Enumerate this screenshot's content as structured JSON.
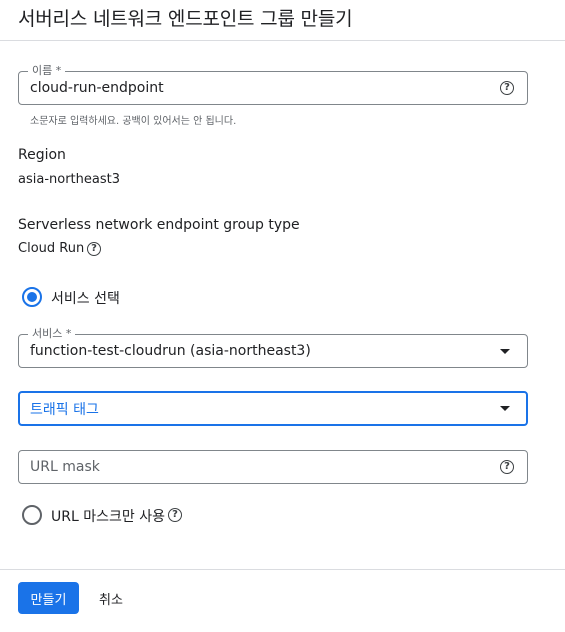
{
  "page": {
    "title": "서버리스 네트워크 엔드포인트 그룹 만들기"
  },
  "name_field": {
    "label": "이름 *",
    "value": "cloud-run-endpoint",
    "hint": "소문자로 입력하세요. 공백이 있어서는 안 됩니다."
  },
  "region": {
    "label": "Region",
    "value": "asia-northeast3"
  },
  "neg_type": {
    "label": "Serverless network endpoint group type",
    "value": "Cloud Run"
  },
  "service_option": {
    "label": "서비스 선택",
    "checked": true
  },
  "service_select": {
    "label": "서비스 *",
    "value": "function-test-cloudrun (asia-northeast3)"
  },
  "traffic_tag_select": {
    "placeholder": "트래픽 태그"
  },
  "url_mask_field": {
    "placeholder": "URL mask"
  },
  "url_mask_option": {
    "label": "URL 마스크만 사용",
    "checked": false
  },
  "actions": {
    "create": "만들기",
    "cancel": "취소"
  },
  "colors": {
    "accent": "#1a73e8",
    "text": "#202124",
    "muted": "#5f6368",
    "border": "#80868b"
  },
  "icons": {
    "help": "help-circle-icon",
    "dropdown": "dropdown-arrow-icon"
  }
}
